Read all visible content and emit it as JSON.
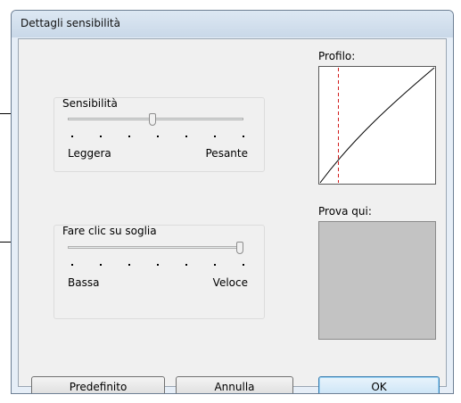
{
  "window": {
    "title": "Dettagli sensibilità"
  },
  "sensitivity": {
    "label": "Sensibilità",
    "min_label": "Leggera",
    "max_label": "Pesante",
    "value_fraction": 0.48
  },
  "click_threshold": {
    "label": "Fare clic su soglia",
    "min_label": "Bassa",
    "max_label": "Veloce",
    "value_fraction": 1.0
  },
  "profile": {
    "label": "Profilo:"
  },
  "test_area": {
    "label": "Prova qui:"
  },
  "buttons": {
    "default_label": "Predefinito",
    "cancel_label": "Annulla",
    "ok_label": "OK"
  },
  "colors": {
    "profile_marker": "#d21e1e",
    "test_area_fill": "#c3c3c3",
    "ok_accent": "#3c7fb1"
  }
}
